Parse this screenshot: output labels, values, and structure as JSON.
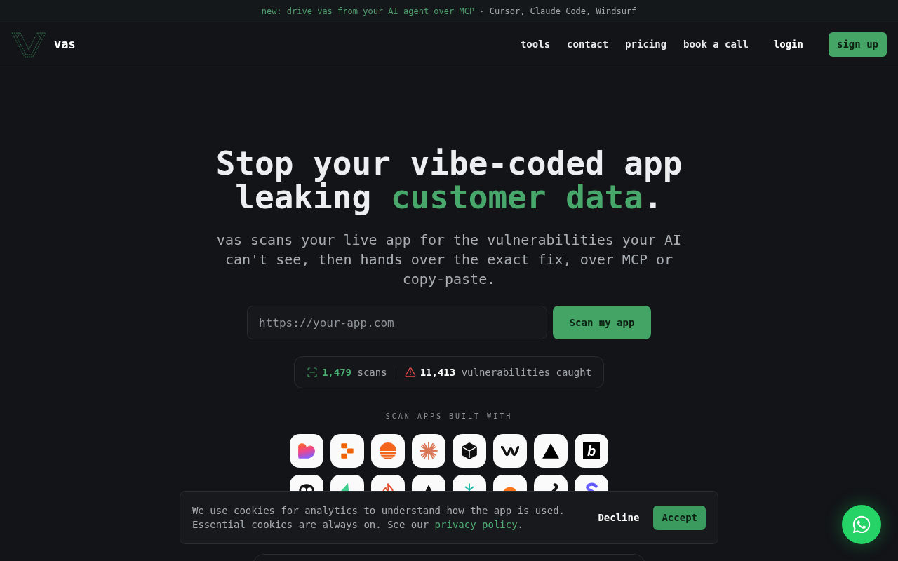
{
  "announcement": {
    "link": "new: drive vas from your AI agent over MCP",
    "text": "· Cursor, Claude Code, Windsurf"
  },
  "nav": {
    "brand": "vas",
    "links": [
      "tools",
      "contact",
      "pricing",
      "book a call"
    ],
    "login": "login",
    "signup": "sign up"
  },
  "hero": {
    "title": "Stop your vibe-coded app leaking",
    "title_highlight": "customer data",
    "title_end": ".",
    "subtitle": "vas scans your live app for the vulnerabilities your AI can't see, then hands over the exact fix, over MCP or copy-paste.",
    "url_field": {
      "placeholder": "https://your-app.com"
    },
    "scan_button": "Scan my app"
  },
  "stats": {
    "scans_count": "1,479",
    "scans_label": "scans",
    "vulns_count": "11,413",
    "vulns_label": "vulnerabilities caught"
  },
  "built_with": {
    "label": "SCAN APPS BUILT WITH",
    "logos": [
      {
        "kind": "heart"
      },
      {
        "kind": "blocks"
      },
      {
        "kind": "sun"
      },
      {
        "kind": "starburst"
      },
      {
        "kind": "cube"
      },
      {
        "kind": "wave"
      },
      {
        "kind": "triangle"
      },
      {
        "kind": "letter-box",
        "text": "b"
      },
      {
        "kind": "mask"
      },
      {
        "kind": "arrow"
      },
      {
        "kind": "flame"
      },
      {
        "kind": "peak"
      },
      {
        "kind": "sprout"
      },
      {
        "kind": "blob"
      },
      {
        "kind": "hook"
      },
      {
        "kind": "curve"
      }
    ]
  },
  "cookie_banner": {
    "text": "We use cookies for analytics to understand how the app is used. Essential cookies are always on. See our",
    "link": "privacy policy",
    "end": ".",
    "decline": "Decline",
    "accept": "Accept"
  }
}
